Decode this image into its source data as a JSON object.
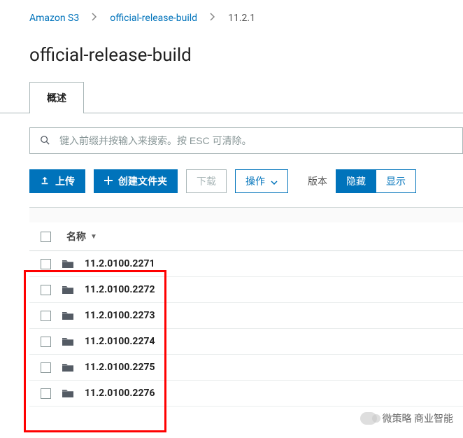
{
  "breadcrumb": {
    "root": "Amazon S3",
    "bucket": "official-release-build",
    "current": "11.2.1"
  },
  "page_title": "official-release-build",
  "tabs": {
    "overview": "概述"
  },
  "search": {
    "placeholder": "键入前缀并按输入来搜索。按 ESC 可清除。"
  },
  "toolbar": {
    "upload": "上传",
    "create_folder": "创建文件夹",
    "download": "下载",
    "actions": "操作",
    "version_label": "版本",
    "hide": "隐藏",
    "show": "显示"
  },
  "table": {
    "column_name": "名称",
    "rows": [
      {
        "name": "11.2.0100.2271"
      },
      {
        "name": "11.2.0100.2272"
      },
      {
        "name": "11.2.0100.2273"
      },
      {
        "name": "11.2.0100.2274"
      },
      {
        "name": "11.2.0100.2275"
      },
      {
        "name": "11.2.0100.2276"
      }
    ]
  },
  "watermark": "微策略 商业智能"
}
